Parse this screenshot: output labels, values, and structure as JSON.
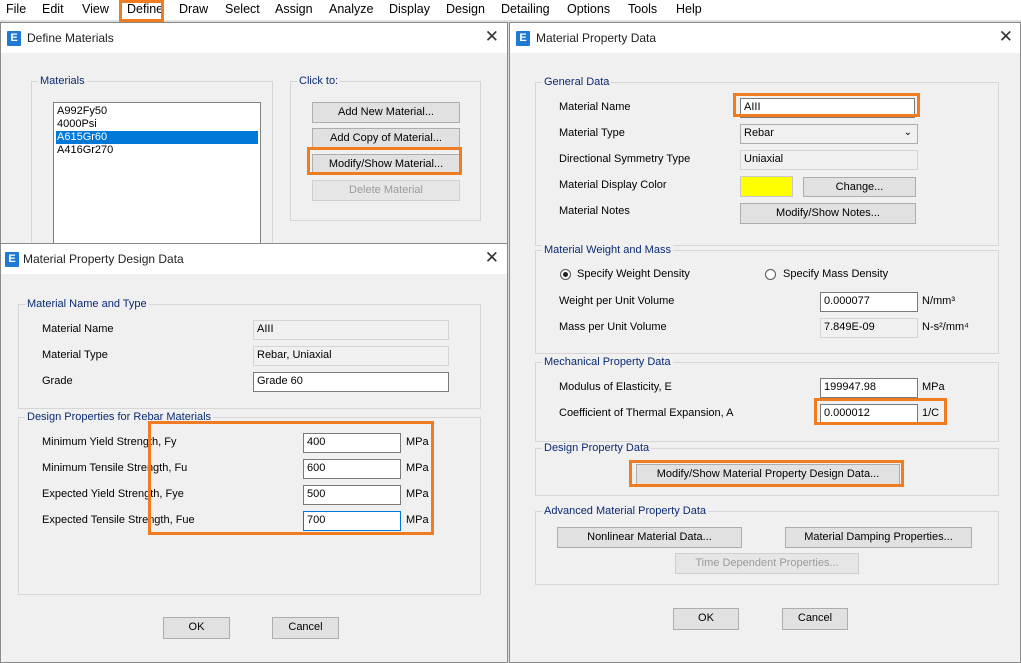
{
  "menubar": {
    "items": [
      "File",
      "Edit",
      "View",
      "Define",
      "Draw",
      "Select",
      "Assign",
      "Analyze",
      "Display",
      "Design",
      "Detailing",
      "Options",
      "Tools",
      "Help"
    ]
  },
  "define_materials": {
    "title": "Define Materials",
    "materials_label": "Materials",
    "materials": [
      "A992Fy50",
      "4000Psi",
      "A615Gr60",
      "A416Gr270"
    ],
    "selected": "A615Gr60",
    "click_to_label": "Click to:",
    "add_new": "Add New Material...",
    "add_copy": "Add Copy of Material...",
    "modify_show": "Modify/Show Material...",
    "delete": "Delete Material"
  },
  "design_data": {
    "title": "Material Property Design Data",
    "name_type_group": "Material Name and Type",
    "material_name_label": "Material Name",
    "material_name_value": "AIII",
    "material_type_label": "Material Type",
    "material_type_value": "Rebar, Uniaxial",
    "grade_label": "Grade",
    "grade_value": "Grade 60",
    "design_group": "Design Properties for Rebar Materials",
    "rows": [
      {
        "label": "Minimum Yield Strength, Fy",
        "value": "400",
        "unit": "MPa"
      },
      {
        "label": "Minimum Tensile Strength, Fu",
        "value": "600",
        "unit": "MPa"
      },
      {
        "label": "Expected Yield Strength, Fye",
        "value": "500",
        "unit": "MPa"
      },
      {
        "label": "Expected Tensile Strength, Fue",
        "value": "700",
        "unit": "MPa"
      }
    ],
    "ok": "OK",
    "cancel": "Cancel"
  },
  "property_data": {
    "title": "Material Property Data",
    "general_group": "General Data",
    "material_name_label": "Material Name",
    "material_name_value": "AIII",
    "material_type_label": "Material Type",
    "material_type_value": "Rebar",
    "symmetry_label": "Directional Symmetry Type",
    "symmetry_value": "Uniaxial",
    "display_color_label": "Material Display Color",
    "display_color": "#ffff00",
    "change_button": "Change...",
    "notes_label": "Material Notes",
    "notes_button": "Modify/Show Notes...",
    "weight_group": "Material Weight and Mass",
    "specify_weight": "Specify Weight Density",
    "specify_mass": "Specify Mass Density",
    "weight_label": "Weight per Unit Volume",
    "weight_value": "0.000077",
    "weight_unit": "N/mm³",
    "mass_label": "Mass per Unit Volume",
    "mass_value": "7.849E-09",
    "mass_unit": "N-s²/mm⁴",
    "mech_group": "Mechanical Property Data",
    "modulus_label": "Modulus of Elasticity,  E",
    "modulus_value": "199947.98",
    "modulus_unit": "MPa",
    "thermal_label": "Coefficient of Thermal Expansion,  A",
    "thermal_value": "0.000012",
    "thermal_unit": "1/C",
    "design_group": "Design Property Data",
    "design_button": "Modify/Show Material Property Design Data...",
    "advanced_group": "Advanced Material Property Data",
    "nonlinear_button": "Nonlinear Material Data...",
    "damping_button": "Material Damping Properties...",
    "time_button": "Time Dependent Properties...",
    "ok": "OK",
    "cancel": "Cancel"
  },
  "colors": {
    "highlight": "#f07c22",
    "accent": "#1e7ad2",
    "group_label": "#0a2a74"
  }
}
